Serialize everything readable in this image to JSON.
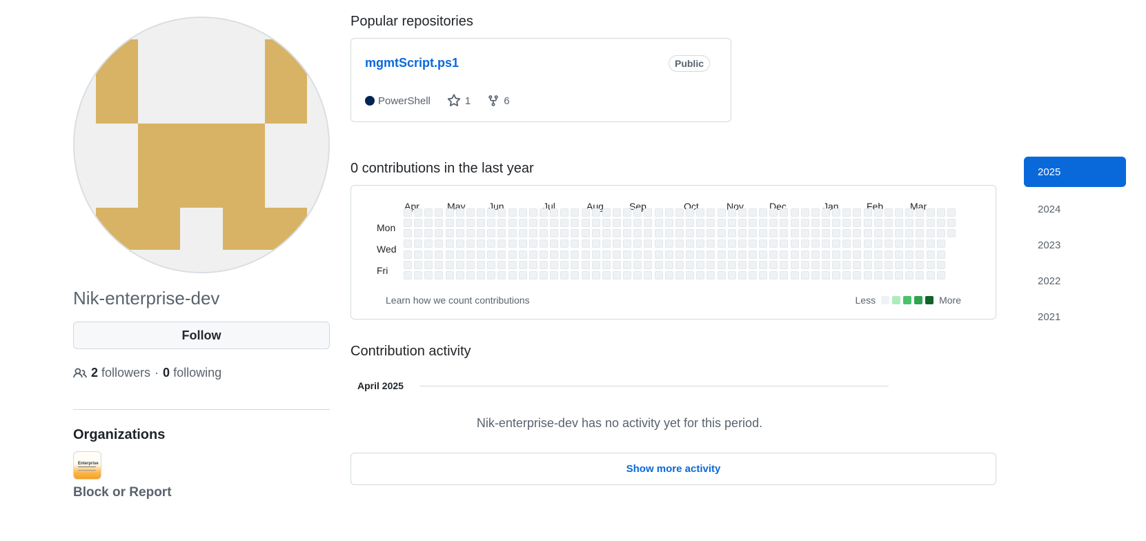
{
  "profile": {
    "username": "Nik-enterprise-dev",
    "follow_label": "Follow",
    "followers_count": "2",
    "followers_label": "followers",
    "separator": "·",
    "following_count": "0",
    "following_label": "following",
    "organizations_title": "Organizations",
    "org_logo_text": "Enterprise",
    "block_report_label": "Block or Report",
    "avatar_color": "#d8b365",
    "avatar_bg": "#f0f0f0"
  },
  "popular": {
    "title": "Popular repositories",
    "repos": [
      {
        "name": "mgmtScript.ps1",
        "visibility": "Public",
        "language": "PowerShell",
        "language_color": "#012456",
        "stars": "1",
        "forks": "6"
      }
    ]
  },
  "contributions": {
    "title": "0 contributions in the last year",
    "months": [
      "Apr",
      "May",
      "Jun",
      "Jul",
      "Aug",
      "Sep",
      "Oct",
      "Nov",
      "Dec",
      "Jan",
      "Feb",
      "Mar"
    ],
    "days": [
      "Mon",
      "Wed",
      "Fri"
    ],
    "learn_link": "Learn how we count contributions",
    "legend_less": "Less",
    "legend_more": "More",
    "legend_colors": [
      "#eff2f5",
      "#aceebb",
      "#4ac26b",
      "#2da44e",
      "#116329"
    ]
  },
  "activity": {
    "title": "Contribution activity",
    "month_heading": "April 2025",
    "no_activity_text": "Nik-enterprise-dev has no activity yet for this period.",
    "show_more_label": "Show more activity"
  },
  "years": {
    "selected": "2025",
    "items": [
      "2025",
      "2024",
      "2023",
      "2022",
      "2021"
    ]
  }
}
